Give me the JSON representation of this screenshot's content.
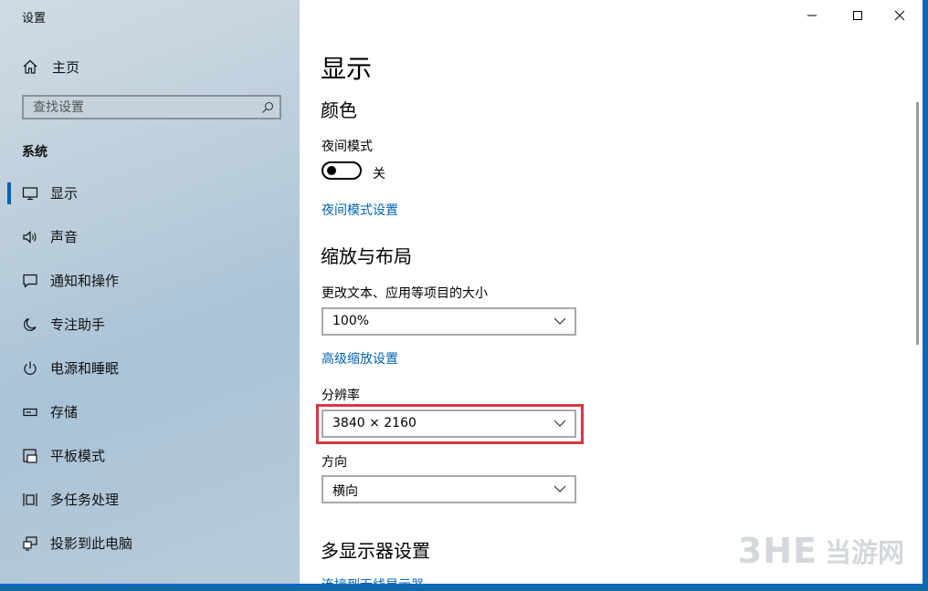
{
  "window": {
    "title": "设置"
  },
  "sidebar": {
    "home_label": "主页",
    "search_placeholder": "查找设置",
    "section_title": "系统",
    "items": [
      {
        "label": "显示",
        "icon": "monitor-icon",
        "active": true
      },
      {
        "label": "声音",
        "icon": "speaker-icon"
      },
      {
        "label": "通知和操作",
        "icon": "message-icon"
      },
      {
        "label": "专注助手",
        "icon": "moon-icon"
      },
      {
        "label": "电源和睡眠",
        "icon": "power-icon"
      },
      {
        "label": "存储",
        "icon": "storage-icon"
      },
      {
        "label": "平板模式",
        "icon": "tablet-icon"
      },
      {
        "label": "多任务处理",
        "icon": "multitask-icon"
      },
      {
        "label": "投影到此电脑",
        "icon": "project-icon"
      }
    ]
  },
  "content": {
    "page_title": "显示",
    "color": {
      "title": "颜色",
      "night_mode_label": "夜间模式",
      "night_mode_state": "关",
      "night_mode_settings_link": "夜间模式设置"
    },
    "scale_layout": {
      "title": "缩放与布局",
      "scale_label": "更改文本、应用等项目的大小",
      "scale_value": "100%",
      "advanced_scaling_link": "高级缩放设置",
      "resolution_label": "分辨率",
      "resolution_value": "3840 × 2160",
      "orientation_label": "方向",
      "orientation_value": "横向"
    },
    "multi_display": {
      "title": "多显示器设置",
      "wireless_link": "连接到无线显示器"
    }
  },
  "watermark": {
    "latin": "3HE",
    "chinese": "当游网"
  },
  "colors": {
    "accent": "#0063b1",
    "highlight_border": "#d9363e",
    "taskbar": "#1466b8"
  }
}
